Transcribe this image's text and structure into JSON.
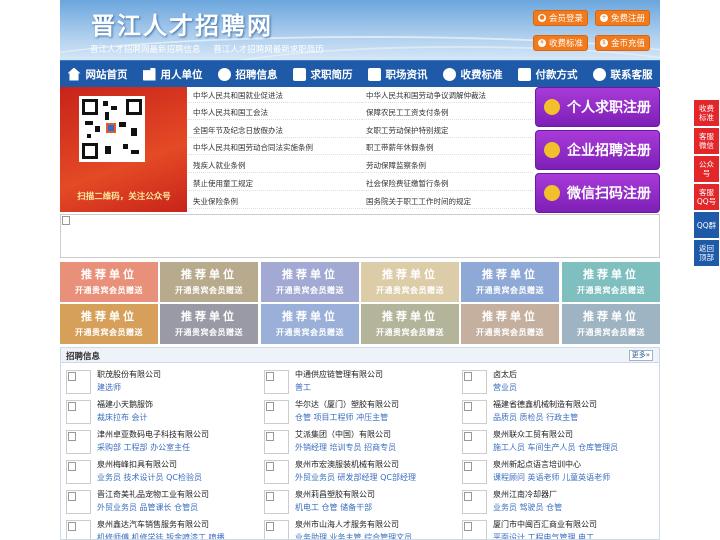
{
  "header": {
    "site_title": "晋江人才招聘网",
    "sub_links": [
      "晋江人才招聘网最新招聘信息",
      "晋江人才招聘网最新求职简历"
    ],
    "buttons": [
      {
        "label": "会员登录",
        "icon": "user-icon"
      },
      {
        "label": "免费注册",
        "icon": "register-icon"
      },
      {
        "label": "收费标准",
        "icon": "yen-icon"
      },
      {
        "label": "金币充值",
        "icon": "coin-icon"
      }
    ]
  },
  "nav": [
    {
      "label": "网站首页",
      "icon": "home-icon"
    },
    {
      "label": "用人单位",
      "icon": "building-icon"
    },
    {
      "label": "招聘信息",
      "icon": "recruit-icon"
    },
    {
      "label": "求职简历",
      "icon": "resume-icon"
    },
    {
      "label": "职场资讯",
      "icon": "news-icon"
    },
    {
      "label": "收费标准",
      "icon": "price-icon"
    },
    {
      "label": "付款方式",
      "icon": "payment-icon"
    },
    {
      "label": "联系客服",
      "icon": "phone-icon"
    }
  ],
  "qr": {
    "caption": "扫描二维码，关注公众号"
  },
  "laws_left": [
    "中华人民共和国就业促进法",
    "中华人民共和国工会法",
    "全国年节及纪念日放假办法",
    "中华人民共和国劳动合同法实施条例",
    "残疾人就业条例",
    "禁止使用童工规定",
    "失业保险条例"
  ],
  "laws_right": [
    "中华人民共和国劳动争议调解仲裁法",
    "保障农民工工资支付条例",
    "女职工劳动保护特别规定",
    "职工带薪年休假条例",
    "劳动保障监察条例",
    "社会保险费征缴暂行条例",
    "国务院关于职工工作时间的规定"
  ],
  "register_buttons": [
    "个人求职注册",
    "企业招聘注册",
    "微信扫码注册"
  ],
  "recommend_tiles": {
    "title": "推荐单位",
    "subtitle": "开通贵宾会员赠送",
    "colors": [
      "#e8907a",
      "#b8aa8c",
      "#a2a9d2",
      "#dccca8",
      "#8ea9d6",
      "#7fbfbf",
      "#d6a05a",
      "#9a9aa6",
      "#9ab0d8",
      "#b4b49a",
      "#c5b0a0",
      "#9fb4c2"
    ]
  },
  "section": {
    "title": "招聘信息",
    "more": "更多»"
  },
  "jobs": [
    {
      "company": "职茂股份有限公司",
      "positions": "建选师"
    },
    {
      "company": "中通供应链管理有限公司",
      "positions": "普工"
    },
    {
      "company": "卤太后",
      "positions": "营业员"
    },
    {
      "company": "福建小天鹅服饰",
      "positions": "裁床拉布 会计"
    },
    {
      "company": "华尔达（厦门）塑胶有限公司",
      "positions": "仓管 项目工程师 冲压主管"
    },
    {
      "company": "福建省德鑫机械制造有限公司",
      "positions": "品质员 质检员 行政主管"
    },
    {
      "company": "津州卓亚数码电子科技有限公司",
      "positions": "采购部 工程部 办公室主任"
    },
    {
      "company": "艾派集团（中国）有限公司",
      "positions": "外销经理 培训专员 招商专员"
    },
    {
      "company": "泉州联众工贸有限公司",
      "positions": "施工人员 车间生产人员 仓库管理员"
    },
    {
      "company": "泉州梅峰扣具有限公司",
      "positions": "业务员 技术设计员 QC检验员"
    },
    {
      "company": "泉州市宏澳服装机械有限公司",
      "positions": "外贸业务员 研发部经理 QC部经理"
    },
    {
      "company": "泉州新起点语言培训中心",
      "positions": "课程顾问 英语老师 儿童英语老师"
    },
    {
      "company": "晋江奇美礼品宠物工业有限公司",
      "positions": "外贸业务员 品管课长 仓管员"
    },
    {
      "company": "泉州莉昌塑胶有限公司",
      "positions": "机电工 仓管 储备干部"
    },
    {
      "company": "泉州江南冷却器厂",
      "positions": "业务员 驾驶员 仓管"
    },
    {
      "company": "泉州鑫达汽车销售服务有限公司",
      "positions": "机修师傅 机修学徒 钣金喷漆工 喷播"
    },
    {
      "company": "泉州市山海人才服务有限公司",
      "positions": "业务助理 业务主管 综合管理文员"
    },
    {
      "company": "厦门市中闽百汇商业有限公司",
      "positions": "平面设计 工程电气管理 电工"
    }
  ],
  "sidebar": [
    {
      "label": "收费标准",
      "color": "#e3262a"
    },
    {
      "label": "客服微信",
      "color": "#e3262a"
    },
    {
      "label": "公众号",
      "color": "#e3262a"
    },
    {
      "label": "客服QQ号",
      "color": "#e3262a"
    },
    {
      "label": "QQ群",
      "color": "#1e5aa8"
    },
    {
      "label": "返回顶部",
      "color": "#1e5aa8"
    }
  ]
}
